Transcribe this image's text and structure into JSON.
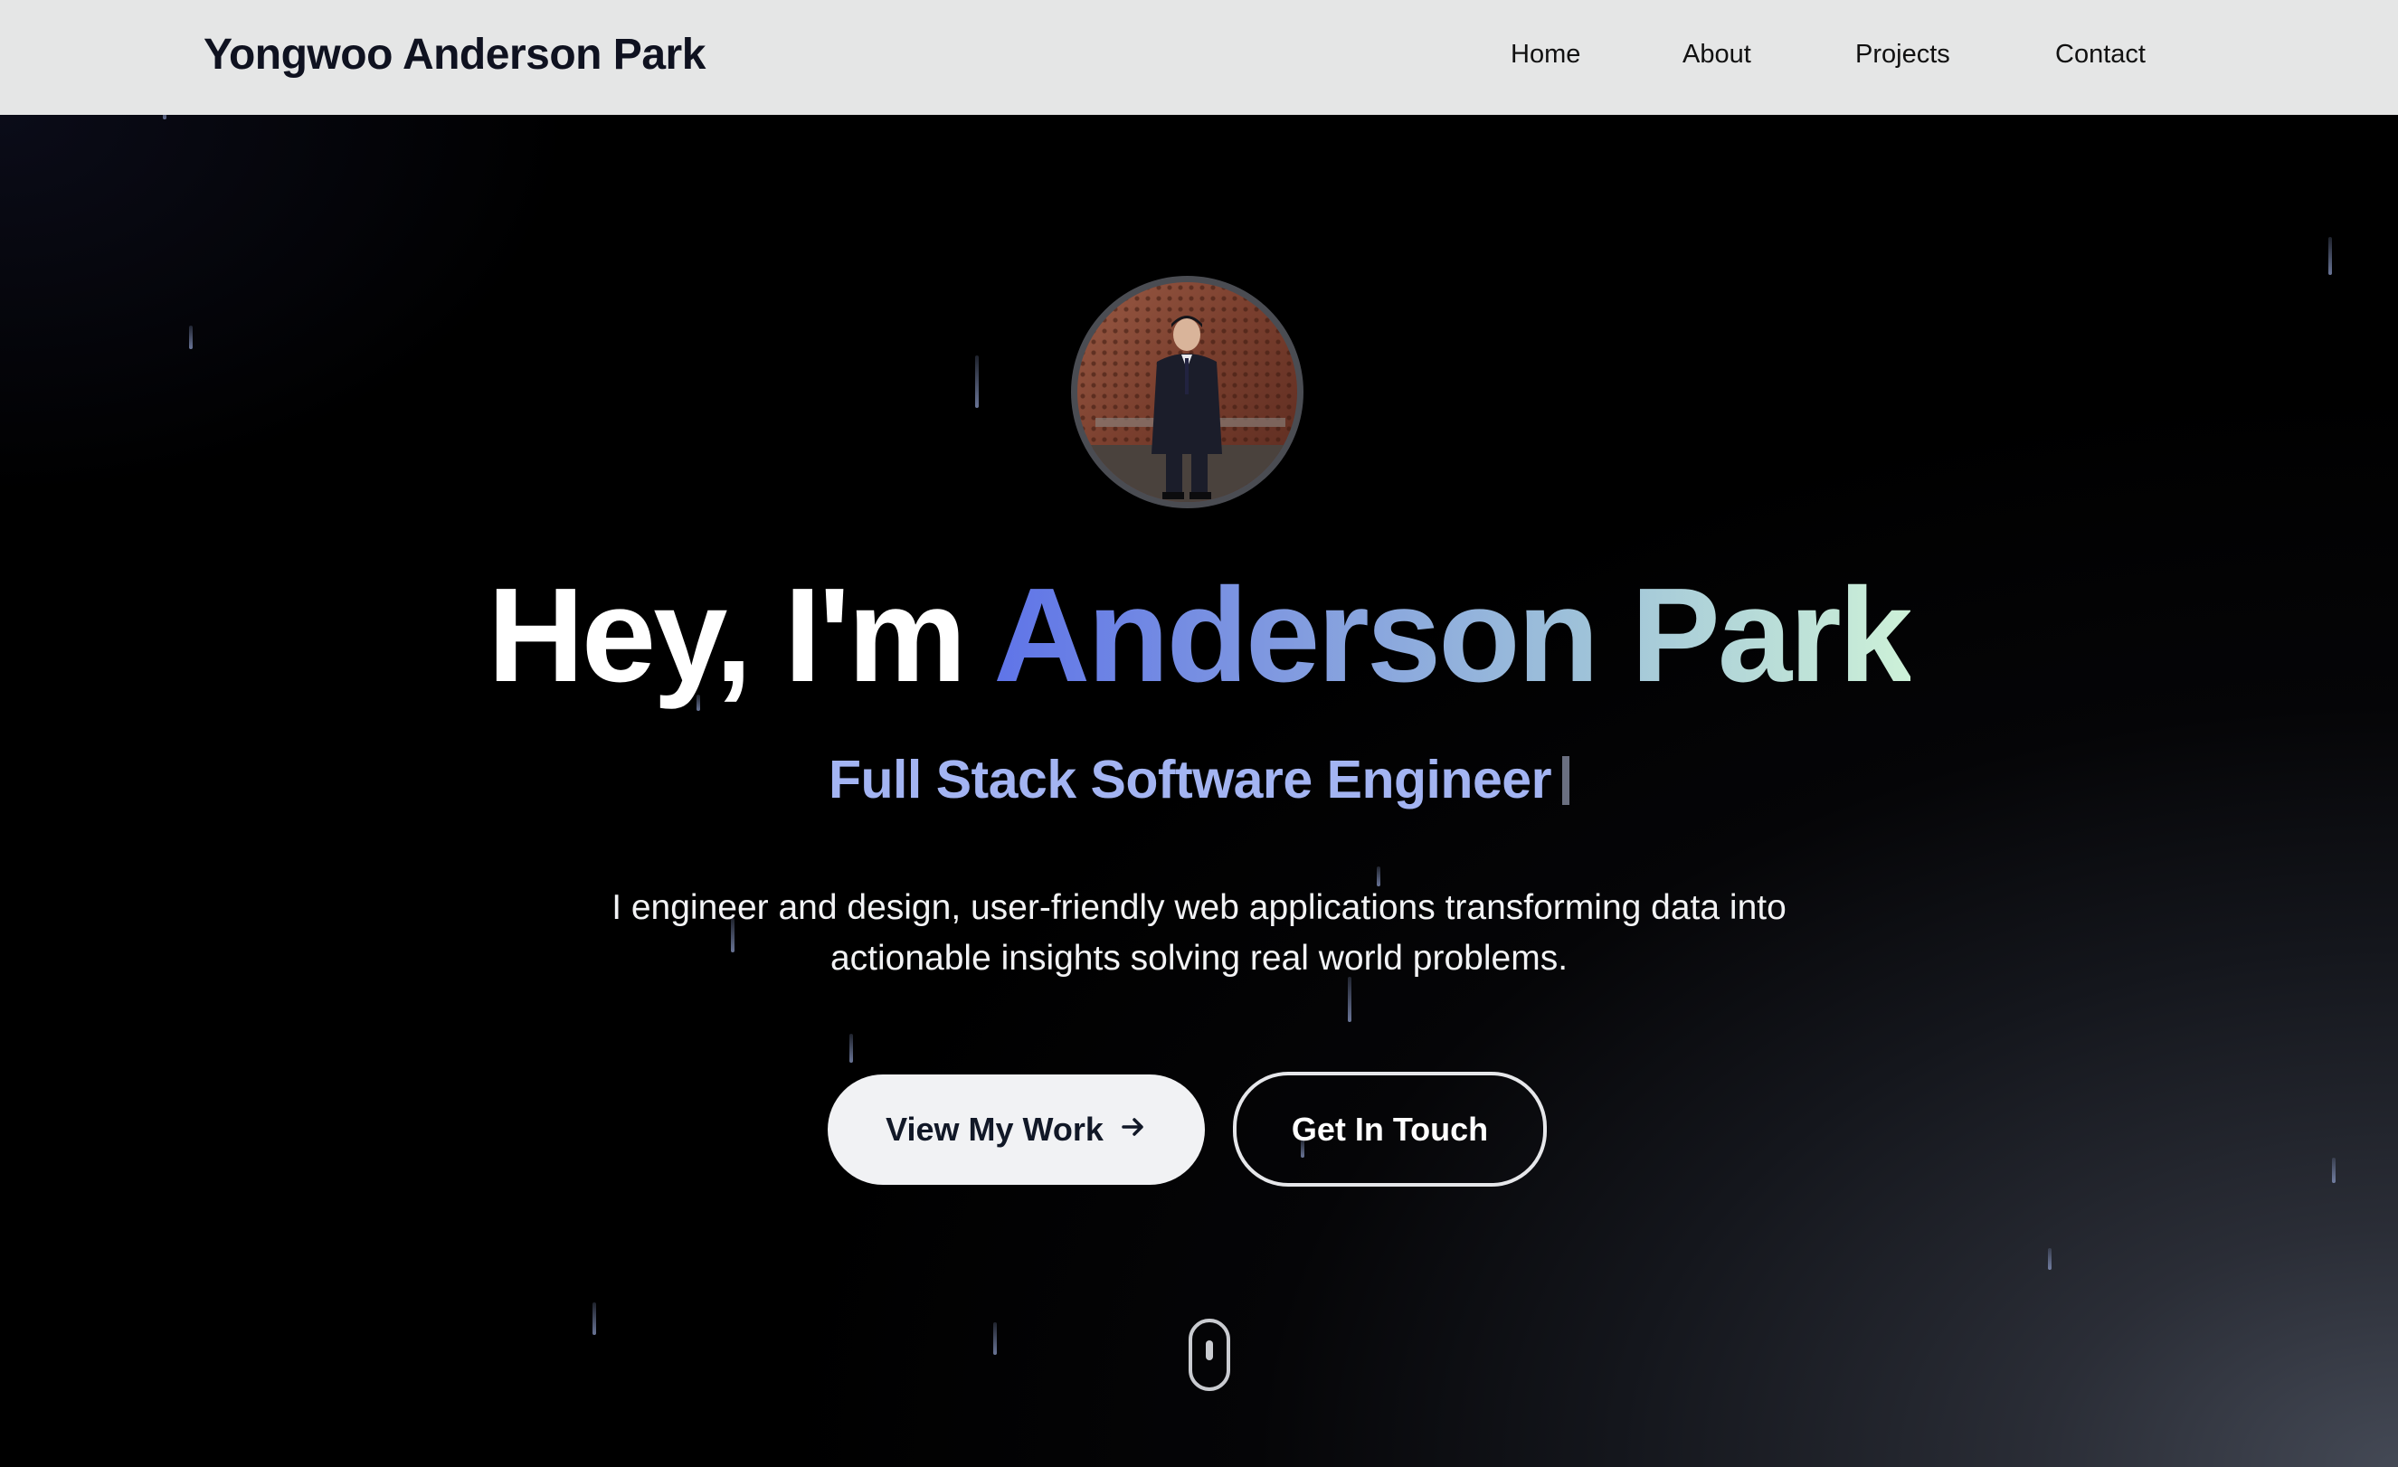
{
  "nav": {
    "brand": "Yongwoo Anderson Park",
    "links": [
      "Home",
      "About",
      "Projects",
      "Contact"
    ]
  },
  "hero": {
    "greeting": "Hey, I'm ",
    "name": "Anderson Park",
    "subtitle": "Full Stack Software Engineer",
    "description_line1": "I engineer and design, user-friendly web applications transforming data into",
    "description_line2": "actionable insights solving real world problems.",
    "primary_button": "View My Work",
    "secondary_button": "Get In Touch"
  },
  "colors": {
    "navbar_bg": "#e5e6e6",
    "subtitle": "#a3b4f2",
    "gradient_start": "#5f74e8",
    "gradient_end": "#cdf1d8"
  },
  "icons": {
    "button_arrow": "arrow-right-icon",
    "scroll_indicator": "mouse-scroll-icon"
  }
}
